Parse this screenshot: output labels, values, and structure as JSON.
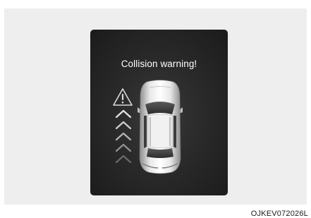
{
  "screen": {
    "message": "Collision warning!"
  },
  "figure": {
    "code": "OJKEV072026L"
  },
  "icons": {
    "warning": "warning-triangle-icon",
    "approach": "chevron-up-icon",
    "vehicle": "car-top-view-icon"
  },
  "colors": {
    "screen_bg": "#2a2a2a",
    "panel_bg": "#eeeeef",
    "text": "#ffffff",
    "chevron_bright": "#e6e6e6",
    "chevron_dim": "#6a6a6a"
  }
}
